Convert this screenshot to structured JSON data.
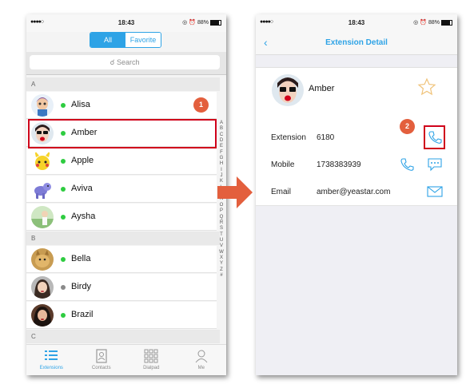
{
  "left_phone": {
    "status": {
      "carrier": "●●●●○",
      "time": "18:43",
      "battery": "88%"
    },
    "segmented": {
      "all": "All",
      "favorite": "Favorite"
    },
    "search": {
      "placeholder": "Search"
    },
    "sections": [
      {
        "letter": "A",
        "contacts": [
          {
            "name": "Alisa",
            "presence": "online"
          },
          {
            "name": "Amber",
            "presence": "online"
          },
          {
            "name": "Apple",
            "presence": "online"
          },
          {
            "name": "Aviva",
            "presence": "online"
          },
          {
            "name": "Aysha",
            "presence": "online"
          }
        ]
      },
      {
        "letter": "B",
        "contacts": [
          {
            "name": "Bella",
            "presence": "online"
          },
          {
            "name": "Birdy",
            "presence": "offline"
          },
          {
            "name": "Brazil",
            "presence": "online"
          }
        ]
      },
      {
        "letter": "C",
        "contacts": []
      }
    ],
    "index": [
      "A",
      "B",
      "C",
      "D",
      "E",
      "F",
      "G",
      "H",
      "I",
      "J",
      "K",
      "L",
      "M",
      "N",
      "O",
      "P",
      "Q",
      "R",
      "S",
      "T",
      "U",
      "V",
      "W",
      "X",
      "Y",
      "Z",
      "#"
    ],
    "tabs": [
      {
        "label": "Extensions",
        "icon": "list-icon",
        "active": true
      },
      {
        "label": "Contacts",
        "icon": "contacts-book-icon",
        "active": false
      },
      {
        "label": "Dialpad",
        "icon": "dialpad-icon",
        "active": false
      },
      {
        "label": "Me",
        "icon": "person-icon",
        "active": false
      }
    ],
    "badge": "1"
  },
  "right_phone": {
    "status": {
      "carrier": "●●●●○",
      "time": "18:43",
      "battery": "88%"
    },
    "title": "Extension Detail",
    "contact_name": "Amber",
    "fields": [
      {
        "label": "Extension",
        "value": "6180"
      },
      {
        "label": "Mobile",
        "value": "1738383939"
      },
      {
        "label": "Email",
        "value": "amber@yeastar.com"
      }
    ],
    "badge": "2"
  },
  "colors": {
    "accent": "#2ea3e6",
    "online": "#2ecc40",
    "offline": "#8a8a8a",
    "highlight": "#d0021b",
    "badge": "#e35f3d"
  }
}
